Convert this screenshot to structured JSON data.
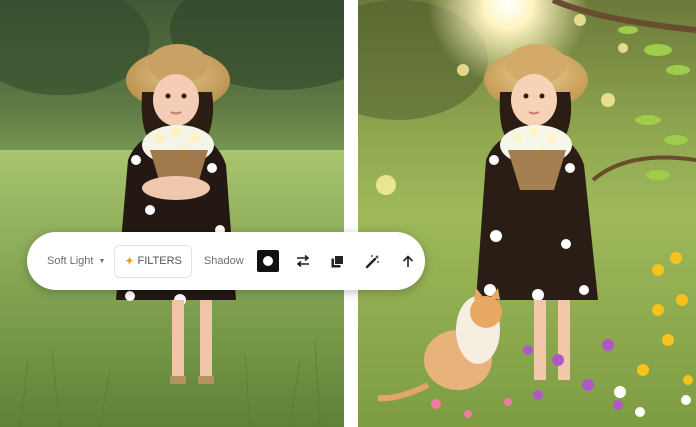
{
  "toolbar": {
    "blend_mode": "Soft Light",
    "filters_label": "FILTERS",
    "shadow_label": "Shadow"
  },
  "icons": {
    "blend_caret": "chevron-down-icon",
    "filters": "sparkle-icon",
    "shadow_color": "shadow-color-swatch",
    "flip": "swap-arrows-icon",
    "layers": "duplicate-layers-icon",
    "magic": "magic-wand-icon",
    "forward": "arrow-up-icon"
  },
  "colors": {
    "toolbar_bg": "#ffffff",
    "accent_sparkle": "#f2a21c",
    "swatch": "#111111"
  }
}
